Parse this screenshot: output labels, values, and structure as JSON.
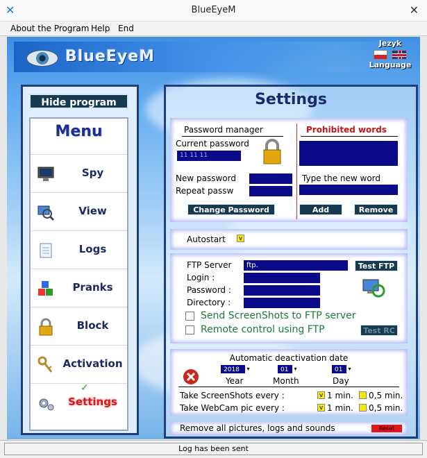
{
  "window": {
    "title": "BlueEyeM",
    "close_glyph": "✕"
  },
  "menubar": {
    "items": [
      "About the Program",
      "Help",
      "End"
    ]
  },
  "header": {
    "logo_text": "BlueEyeM",
    "lang_title": "Jezyk",
    "lang_label": "Language"
  },
  "left": {
    "hide_button": "Hide program",
    "menu_title": "Menu",
    "items": [
      {
        "label": "Spy",
        "icon": "monitor-icon"
      },
      {
        "label": "View",
        "icon": "magnifier-icon"
      },
      {
        "label": "Logs",
        "icon": "notepad-icon"
      },
      {
        "label": "Pranks",
        "icon": "blocks-icon"
      },
      {
        "label": "Block",
        "icon": "padlock-icon"
      },
      {
        "label": "Activation",
        "icon": "keys-icon"
      },
      {
        "label": "Settings",
        "icon": "gears-icon"
      }
    ],
    "check_glyph": "✓"
  },
  "settings": {
    "title": "Settings",
    "password": {
      "header": "Password manager",
      "current_label": "Current password",
      "current_value": "11 11 11",
      "new_label": "New password",
      "repeat_label": "Repeat passw",
      "change_button": "Change Password"
    },
    "prohibited": {
      "header": "Prohibited words",
      "type_label": "Type the new word",
      "add_button": "Add",
      "remove_button": "Remove"
    },
    "autostart": {
      "label": "Autostart",
      "check": "v"
    },
    "ftp": {
      "server_label": "FTP Server",
      "server_value": "ftp.",
      "test_button": "Test FTP",
      "login_label": "Login :",
      "password_label": "Password :",
      "directory_label": "Directory :",
      "send_label": "Send ScreenShots to FTP server",
      "remote_label": "Remote control using FTP",
      "test_rc_button": "Test RC"
    },
    "deactivation": {
      "header": "Automatic deactivation date",
      "year_value": "2018",
      "month_value": "01",
      "day_value": "01",
      "year_label": "Year",
      "month_label": "Month",
      "day_label": "Day",
      "screenshots_label": "Take ScreenShots every :",
      "webcam_label": "Take WebCam pic every :",
      "opt1": "1 min.",
      "opt2": "0,5 min.",
      "check": "v"
    },
    "remove_all": {
      "label": "Remove all pictures, logs and sounds",
      "button": "Reset"
    }
  },
  "status": {
    "text": "Log has been sent"
  }
}
